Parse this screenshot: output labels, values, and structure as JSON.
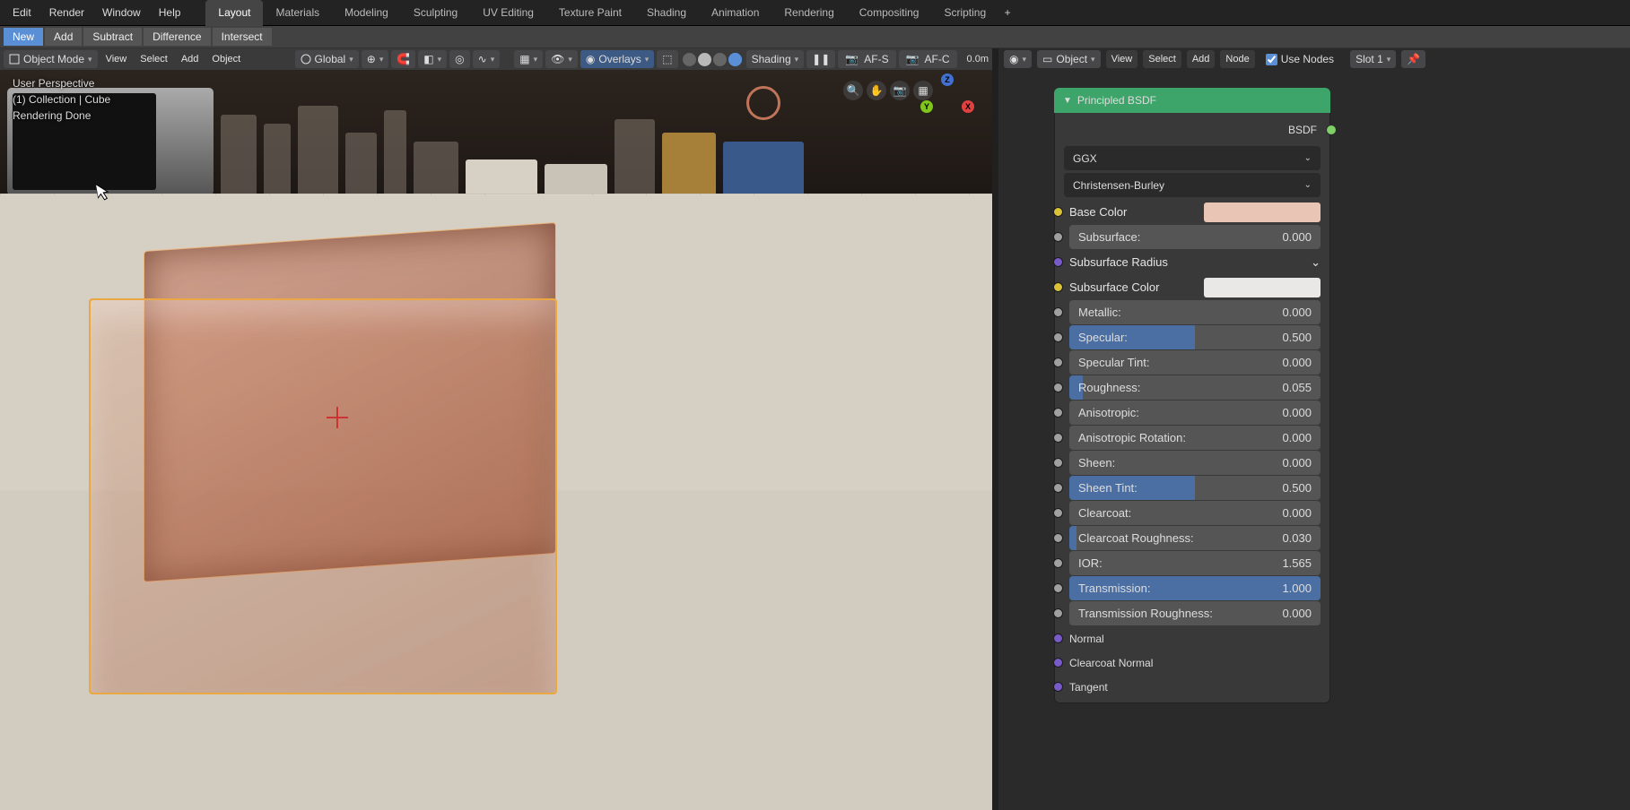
{
  "top_menu": {
    "edit": "Edit",
    "render": "Render",
    "window": "Window",
    "help": "Help"
  },
  "workspaces": {
    "layout": "Layout",
    "materials": "Materials",
    "modeling": "Modeling",
    "sculpting": "Sculpting",
    "uv": "UV Editing",
    "tex": "Texture Paint",
    "shading": "Shading",
    "anim": "Animation",
    "rendering": "Rendering",
    "comp": "Compositing",
    "script": "Scripting"
  },
  "boolean_tabs": {
    "new": "New",
    "add": "Add",
    "subtract": "Subtract",
    "difference": "Difference",
    "intersect": "Intersect"
  },
  "viewport": {
    "mode": "Object Mode",
    "menus": {
      "view": "View",
      "select": "Select",
      "add": "Add",
      "object": "Object"
    },
    "orient": "Global",
    "overlays": "Overlays",
    "shading": "Shading",
    "af_s": "AF-S",
    "af_c": "AF-C",
    "distance": "0.0m",
    "info1": "User Perspective",
    "info2": "(1) Collection | Cube",
    "info3": "Rendering Done",
    "gizmo": {
      "x": "X",
      "y": "Y",
      "z": "Z"
    }
  },
  "node_editor": {
    "menus": {
      "object": "Object",
      "view": "View",
      "select": "Select",
      "add": "Add",
      "node": "Node"
    },
    "use_nodes": "Use Nodes",
    "slot": "Slot 1"
  },
  "node": {
    "title": "Principled BSDF",
    "out": "BSDF",
    "ggx": "GGX",
    "cb": "Christensen-Burley",
    "base_color": {
      "label": "Base Color",
      "hex": "#e8c5b5"
    },
    "subsurface": {
      "label": "Subsurface:",
      "value": "0.000"
    },
    "ss_radius": "Subsurface Radius",
    "ss_color": {
      "label": "Subsurface Color",
      "hex": "#e9e8e6"
    },
    "metallic": {
      "label": "Metallic:",
      "value": "0.000",
      "fill": 0
    },
    "specular": {
      "label": "Specular:",
      "value": "0.500",
      "fill": 50
    },
    "spec_tint": {
      "label": "Specular Tint:",
      "value": "0.000",
      "fill": 0
    },
    "roughness": {
      "label": "Roughness:",
      "value": "0.055",
      "fill": 5.5
    },
    "aniso": {
      "label": "Anisotropic:",
      "value": "0.000",
      "fill": 0
    },
    "aniso_rot": {
      "label": "Anisotropic Rotation:",
      "value": "0.000",
      "fill": 0
    },
    "sheen": {
      "label": "Sheen:",
      "value": "0.000",
      "fill": 0
    },
    "sheen_tint": {
      "label": "Sheen Tint:",
      "value": "0.500",
      "fill": 50
    },
    "clearcoat": {
      "label": "Clearcoat:",
      "value": "0.000",
      "fill": 0
    },
    "cc_rough": {
      "label": "Clearcoat Roughness:",
      "value": "0.030",
      "fill": 3
    },
    "ior": {
      "label": "IOR:",
      "value": "1.565"
    },
    "transmission": {
      "label": "Transmission:",
      "value": "1.000",
      "fill": 100
    },
    "trans_rough": {
      "label": "Transmission Roughness:",
      "value": "0.000",
      "fill": 0
    },
    "normal": "Normal",
    "cc_normal": "Clearcoat Normal",
    "tangent": "Tangent"
  }
}
